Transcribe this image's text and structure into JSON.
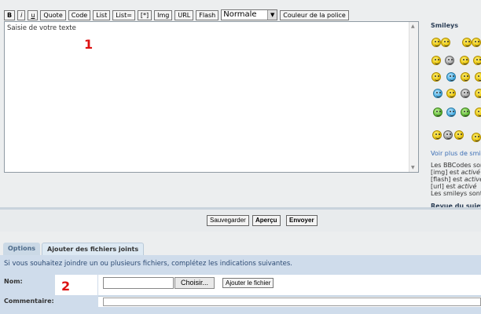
{
  "toolbar": {
    "buttons": [
      "B",
      "i",
      "u",
      "Quote",
      "Code",
      "List",
      "List=",
      "[*]",
      "Img",
      "URL",
      "Flash"
    ],
    "font_size_selected": "Normale",
    "font_color_label": "Couleur de la police"
  },
  "editor": {
    "placeholder": "Saisie de votre texte"
  },
  "markers": {
    "one": "1",
    "two": "2"
  },
  "sidebar": {
    "title": "Smileys",
    "more_link": "Voir plus de smileys",
    "bbcode_line": "Les BBCodes sont",
    "img_line": "[img] est ",
    "flash_line": "[flash] est ",
    "url_line": "[url] est ",
    "active_word": "activé",
    "smileys_line": "Les smileys sont",
    "review": "Revue du sujet"
  },
  "actions": {
    "save": "Sauvegarder",
    "preview": "Aperçu",
    "send": "Envoyer"
  },
  "tabs": {
    "options": "Options",
    "attachments": "Ajouter des fichiers joints"
  },
  "attachments": {
    "description": "Si vous souhaitez joindre un ou plusieurs fichiers, complétez les indications suivantes.",
    "name_label": "Nom:",
    "choose_button": "Choisir...",
    "add_file_button": "Ajouter le fichier",
    "comment_label": "Commentaire:"
  },
  "colors": {
    "page_bg": "#eceeef",
    "panel_bg": "#cfdceb",
    "marker_red": "#dd1111",
    "link_blue": "#3b6eb5"
  }
}
